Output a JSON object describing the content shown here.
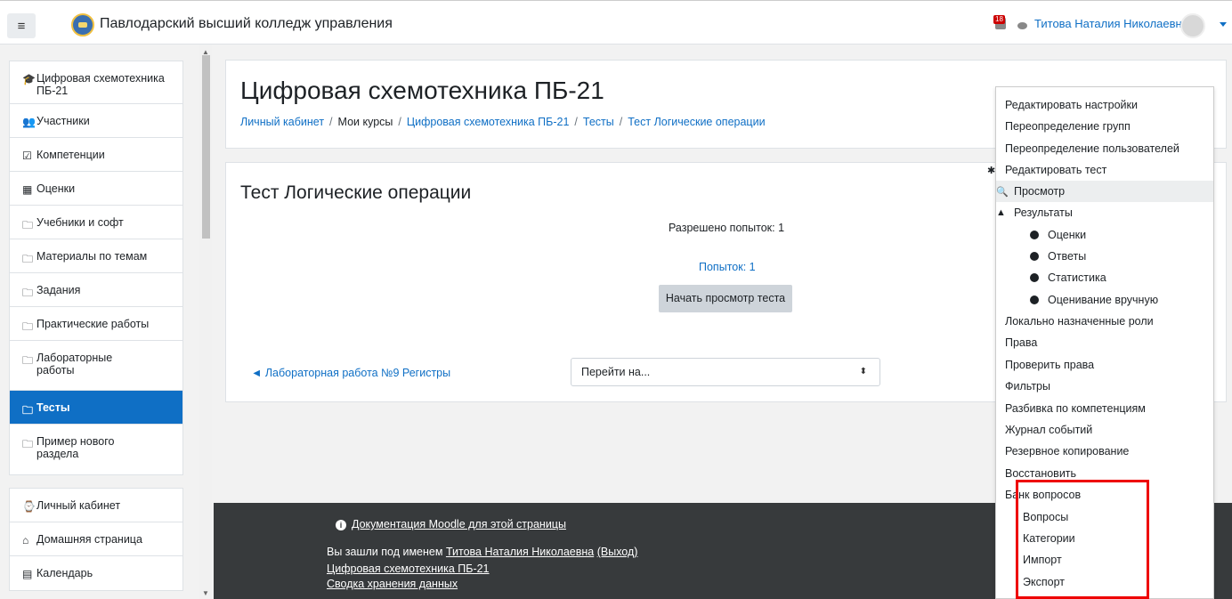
{
  "header": {
    "menu_icon": "hamburger-icon",
    "site_name": "Павлодарский высший колледж управления",
    "notification_count": "18",
    "user_name": "Титова Наталия Николаевна"
  },
  "sidebar": {
    "items": [
      {
        "label": "Цифровая схемотехника ПБ-21",
        "icon": "graduation-cap-icon"
      },
      {
        "label": "Участники",
        "icon": "users-icon"
      },
      {
        "label": "Компетенции",
        "icon": "checkbox-icon"
      },
      {
        "label": "Оценки",
        "icon": "table-icon"
      },
      {
        "label": "Учебники и софт",
        "icon": "folder-icon"
      },
      {
        "label": "Материалы по темам",
        "icon": "folder-icon"
      },
      {
        "label": "Задания",
        "icon": "folder-icon"
      },
      {
        "label": "Практические работы",
        "icon": "folder-icon"
      },
      {
        "label": "Лабораторные работы",
        "icon": "folder-icon"
      },
      {
        "label": "Тесты",
        "icon": "folder-icon"
      },
      {
        "label": "Пример нового раздела",
        "icon": "folder-icon"
      }
    ],
    "items2": [
      {
        "label": "Личный кабинет",
        "icon": "dashboard-icon"
      },
      {
        "label": "Домашняя страница",
        "icon": "home-icon"
      },
      {
        "label": "Календарь",
        "icon": "calendar-icon"
      }
    ]
  },
  "course": {
    "title": "Цифровая схемотехника ПБ-21",
    "breadcrumb": [
      "Личный кабинет",
      "Мои курсы",
      "Цифровая схемотехника ПБ-21",
      "Тесты",
      "Тест Логические операции"
    ]
  },
  "quiz": {
    "title": "Тест Логические операции",
    "allowed": "Разрешено попыток: 1",
    "attempts": "Попыток: 1",
    "preview_button": "Начать просмотр теста",
    "prev_link": "◄ Лабораторная работа №9 Регистры",
    "jump_select": "Перейти на..."
  },
  "footer": {
    "doc_link": "Документация Moodle для этой страницы",
    "logged_prefix": "Вы зашли под именем",
    "logged_user": "Титова Наталия Николаевна",
    "logout": "(Выход)",
    "course_link": "Цифровая схемотехника ПБ-21",
    "data_link": "Сводка хранения данных"
  },
  "admin_menu": {
    "items": [
      {
        "label": "Редактировать настройки"
      },
      {
        "label": "Переопределение групп"
      },
      {
        "label": "Переопределение пользователей"
      },
      {
        "label": "Редактировать тест",
        "icon": "gear-icon"
      },
      {
        "label": "Просмотр",
        "icon": "magnifier-icon"
      },
      {
        "label": "Результаты",
        "icon": "area-chart-icon"
      },
      {
        "label": "Оценки",
        "bullet": true
      },
      {
        "label": "Ответы",
        "bullet": true
      },
      {
        "label": "Статистика",
        "bullet": true
      },
      {
        "label": "Оценивание вручную",
        "bullet": true
      },
      {
        "label": "Локально назначенные роли"
      },
      {
        "label": "Права"
      },
      {
        "label": "Проверить права"
      },
      {
        "label": "Фильтры"
      },
      {
        "label": "Разбивка по компетенциям"
      },
      {
        "label": "Журнал событий"
      },
      {
        "label": "Резервное копирование"
      },
      {
        "label": "Восстановить"
      },
      {
        "label": "Банк вопросов"
      },
      {
        "label": "Вопросы",
        "indent": true
      },
      {
        "label": "Категории",
        "indent": true
      },
      {
        "label": "Импорт",
        "indent": true
      },
      {
        "label": "Экспорт",
        "indent": true
      }
    ]
  },
  "colors": {
    "accent": "#0f6fc5",
    "footer_bg": "#373a3c",
    "highlight": "#e00000"
  }
}
